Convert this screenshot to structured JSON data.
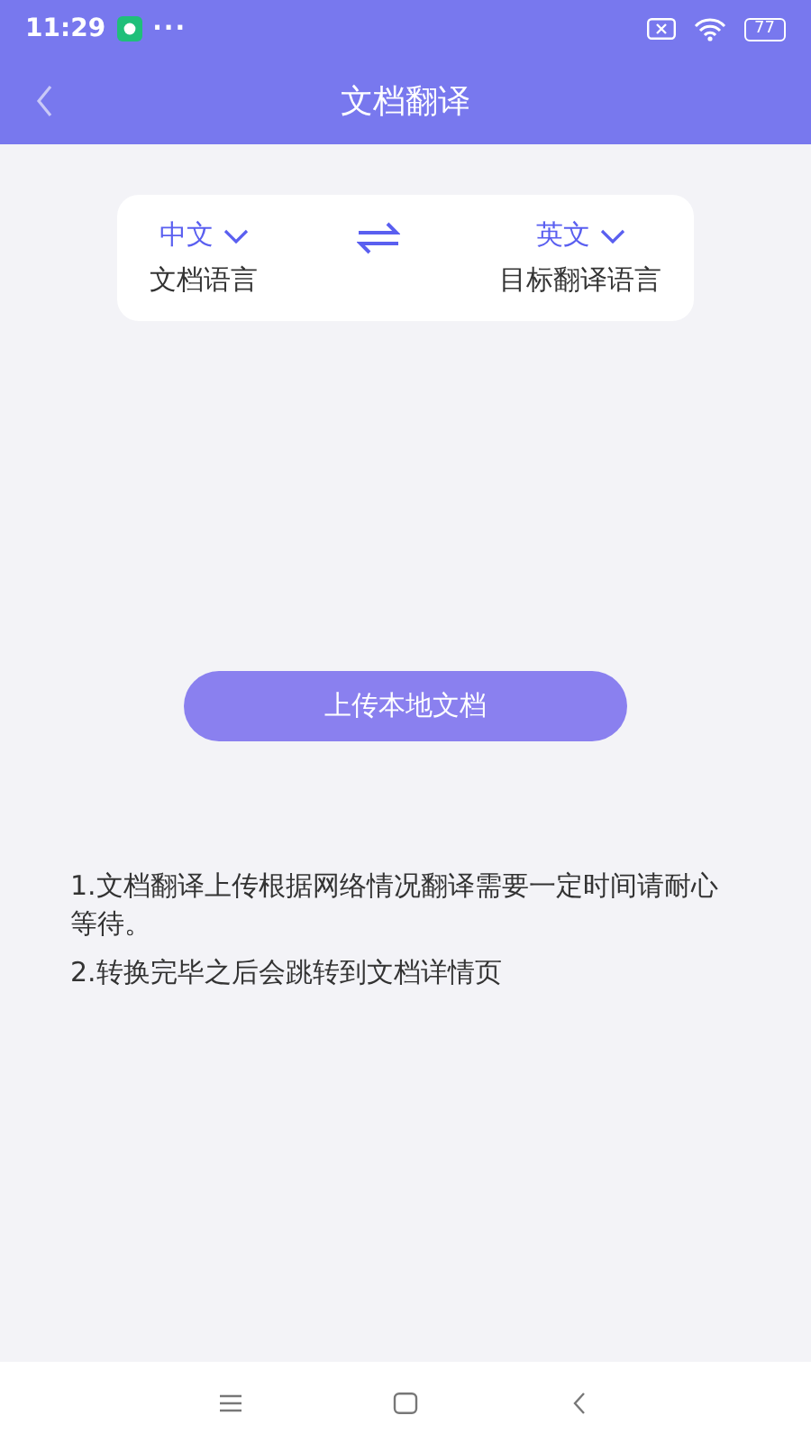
{
  "status_bar": {
    "time": "11:29",
    "more": "···",
    "battery": "77"
  },
  "header": {
    "title": "文档翻译"
  },
  "languages": {
    "source": {
      "value": "中文",
      "label": "文档语言"
    },
    "target": {
      "value": "英文",
      "label": "目标翻译语言"
    }
  },
  "upload_button": "上传本地文档",
  "notes": [
    "1.文档翻译上传根据网络情况翻译需要一定时间请耐心等待。",
    "2.转换完毕之后会跳转到文档详情页"
  ]
}
